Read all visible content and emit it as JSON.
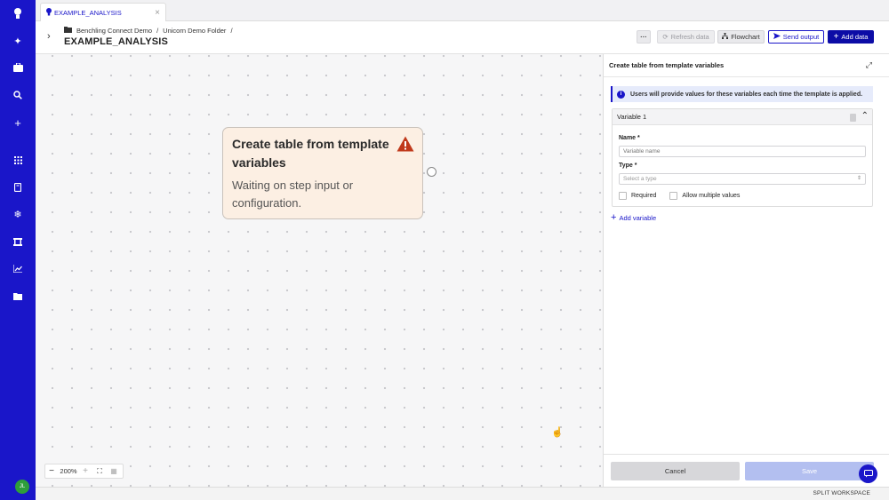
{
  "rail": {
    "icons": [
      "benchling-logo-icon",
      "sparkle-icon",
      "briefcase-icon",
      "search-icon",
      "plus-icon",
      "grid-icon",
      "notebook-icon",
      "snowflake-icon",
      "workflow-icon",
      "chart-icon",
      "folder-icon"
    ],
    "avatar": "JL"
  },
  "tab": {
    "label": "EXAMPLE_ANALYSIS"
  },
  "breadcrumb": {
    "items": [
      "Benchling Connect Demo",
      "/",
      "Unicorn Demo Folder",
      "/"
    ]
  },
  "header": {
    "title": "EXAMPLE_ANALYSIS"
  },
  "toolbar": {
    "more_label": "···",
    "refresh_label": "Refresh data",
    "flowchart_label": "Flowchart",
    "send_label": "Send output",
    "add_label": "Add data"
  },
  "node": {
    "title": "Create table from template variables",
    "status": "Waiting on step input or configuration."
  },
  "zoom": {
    "minus": "−",
    "value": "200%",
    "plus": "+"
  },
  "panel": {
    "title": "Create table from template variables",
    "info": "Users will provide values for these variables each time the template is applied.",
    "variable": {
      "header": "Variable 1",
      "name_label": "Name *",
      "name_placeholder": "Variable name",
      "type_label": "Type *",
      "type_placeholder": "Select a type",
      "required_label": "Required",
      "multiple_label": "Allow multiple values"
    },
    "add_variable": "Add variable",
    "cancel": "Cancel",
    "save": "Save"
  },
  "footer": {
    "split": "SPLIT WORKSPACE"
  },
  "colors": {
    "accent": "#1a16c9",
    "node_bg": "#fcefe3",
    "warning": "#c0391b"
  }
}
